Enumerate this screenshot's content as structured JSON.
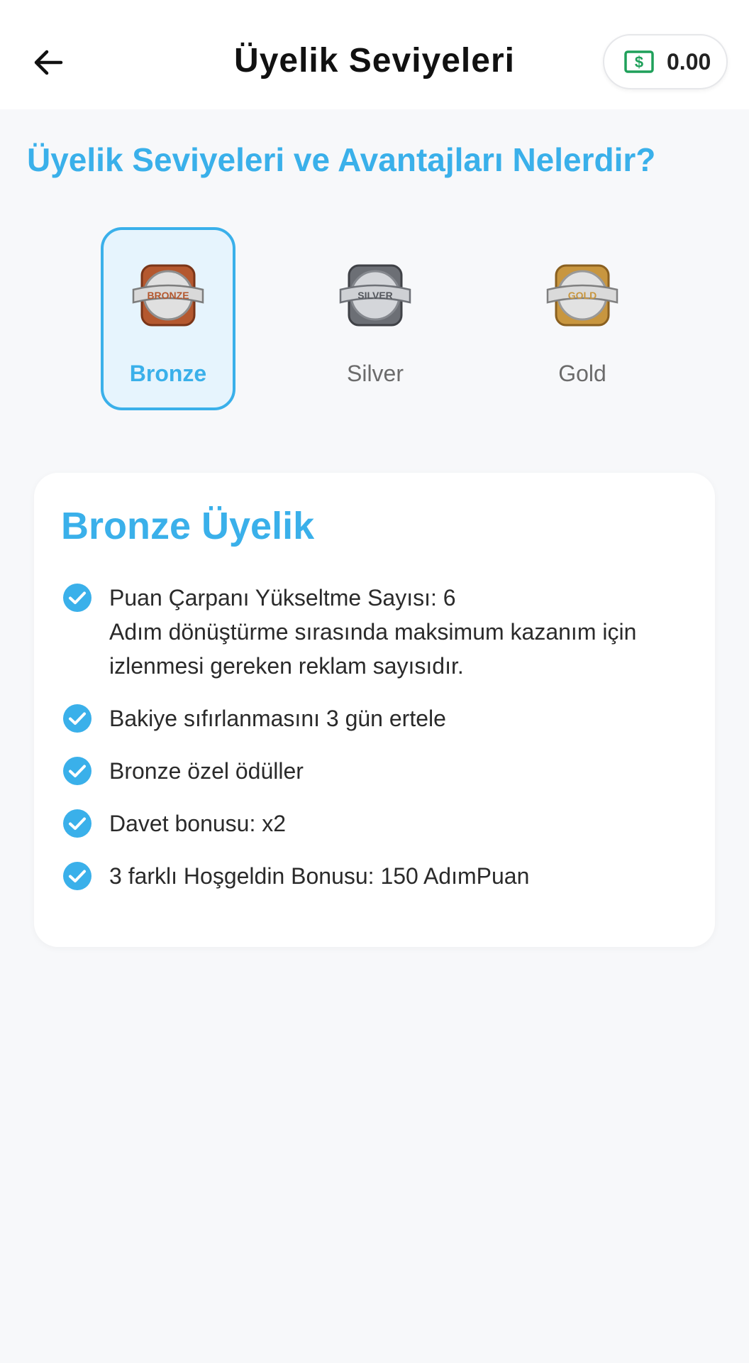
{
  "header": {
    "title": "Üyelik Seviyeleri",
    "back_icon": "arrow-left-icon",
    "balance": "0.00",
    "balance_icon": "cash-icon"
  },
  "heading": "Üyelik Seviyeleri ve Avantajları Nelerdir?",
  "tiers": [
    {
      "label": "Bronze",
      "badge_text": "BRONZE",
      "selected": true,
      "color": "#c0673a"
    },
    {
      "label": "Silver",
      "badge_text": "SILVER",
      "selected": false,
      "color": "#8c8f96"
    },
    {
      "label": "Gold",
      "badge_text": "GOLD",
      "selected": false,
      "color": "#d3a24a"
    }
  ],
  "card": {
    "title": "Bronze Üyelik",
    "benefits": [
      {
        "line1": "Puan Çarpanı Yükseltme Sayısı: 6",
        "line2": "Adım dönüştürme sırasında maksimum kazanım için",
        "line3": "izlenmesi gereken reklam sayısıdır."
      },
      {
        "line1": "Bakiye sıfırlanmasını 3 gün ertele"
      },
      {
        "line1": "Bronze özel ödüller"
      },
      {
        "line1": "Davet bonusu: x2"
      },
      {
        "line1": "3 farklı Hoşgeldin Bonusu: 150 AdımPuan"
      }
    ]
  },
  "colors": {
    "accent": "#3ab0ea",
    "background": "#f7f8fa",
    "cash_green": "#1fa05a"
  }
}
